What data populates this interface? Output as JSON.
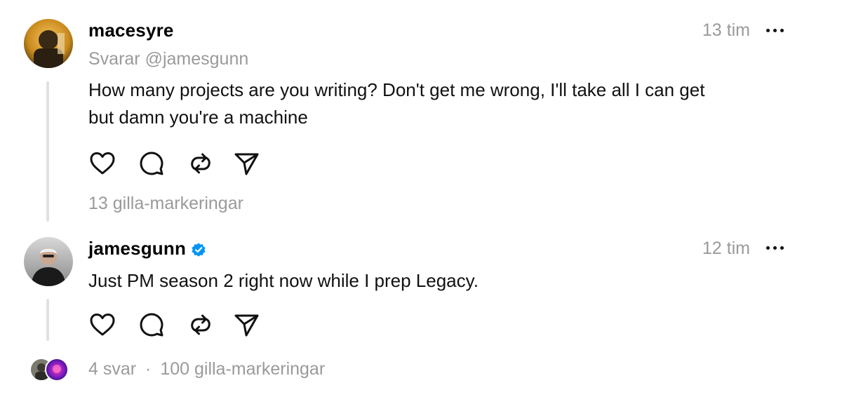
{
  "posts": [
    {
      "username": "macesyre",
      "reply_to": "Svarar @jamesgunn",
      "time": "13 tim",
      "body": [
        "How many projects are you writing? Don't get me wrong, I'll take all I can get",
        "but damn you're a machine"
      ],
      "likes": "13 gilla-markeringar"
    },
    {
      "username": "jamesgunn",
      "verified": true,
      "time": "12 tim",
      "body": [
        "Just PM season 2 right now while I prep Legacy."
      ]
    }
  ],
  "footer": {
    "replies": "4 svar",
    "separator": "·",
    "likes": "100 gilla-markeringar"
  },
  "icons": {
    "like": "heart-icon",
    "comment": "comment-icon",
    "repost": "repost-icon",
    "share": "send-icon",
    "more": "more-dots-icon",
    "verified": "verified-badge-icon"
  },
  "colors": {
    "verified": "#0095f6",
    "muted_text": "#9a9a9a",
    "thread_line": "#e1e1e1"
  }
}
